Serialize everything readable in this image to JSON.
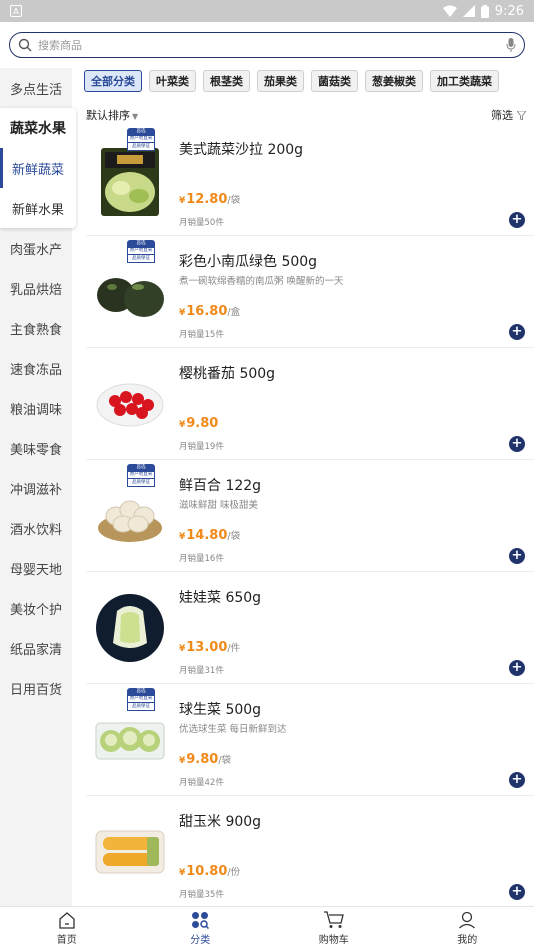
{
  "status": {
    "time": "9:26"
  },
  "search": {
    "placeholder": "搜索商品"
  },
  "sidebar": {
    "top_item": "多点生活",
    "group_title": "蔬菜水果",
    "subitems": [
      "新鲜蔬菜",
      "新鲜水果"
    ],
    "items": [
      "肉蛋水产",
      "乳品烘焙",
      "主食熟食",
      "速食冻品",
      "粮油调味",
      "美味零食",
      "冲调滋补",
      "酒水饮料",
      "母婴天地",
      "美妆个护",
      "纸品家清",
      "日用百货"
    ]
  },
  "tabs": [
    "全部分类",
    "叶菜类",
    "根茎类",
    "茄果类",
    "菌菇类",
    "葱姜椒类",
    "加工类蔬菜"
  ],
  "sort": {
    "label": "默认排序",
    "filter": "筛选"
  },
  "badge": {
    "line1": "首选",
    "line2": "原产地直采",
    "line3": "品质保证"
  },
  "products": [
    {
      "name": "美式蔬菜沙拉 200g",
      "desc": "",
      "price": "12.80",
      "unit": "/袋",
      "sales": "月销量50件"
    },
    {
      "name": "彩色小南瓜绿色 500g",
      "desc": "煮一碗软绵香糯的南瓜粥 唤醒新的一天",
      "price": "16.80",
      "unit": "/盒",
      "sales": "月销量15件"
    },
    {
      "name": "樱桃番茄 500g",
      "desc": "",
      "price": "9.80",
      "unit": "",
      "sales": "月销量19件"
    },
    {
      "name": "鲜百合 122g",
      "desc": "滋味鲜甜 味极甜美",
      "price": "14.80",
      "unit": "/袋",
      "sales": "月销量16件"
    },
    {
      "name": "娃娃菜 650g",
      "desc": "",
      "price": "13.00",
      "unit": "/件",
      "sales": "月销量31件"
    },
    {
      "name": "球生菜 500g",
      "desc": "优选球生菜 每日新鲜到达",
      "price": "9.80",
      "unit": "/袋",
      "sales": "月销量42件"
    },
    {
      "name": "甜玉米 900g",
      "desc": "",
      "price": "10.80",
      "unit": "/份",
      "sales": "月销量35件"
    }
  ],
  "currency": "¥",
  "nav": [
    "首页",
    "分类",
    "购物车",
    "我的"
  ]
}
